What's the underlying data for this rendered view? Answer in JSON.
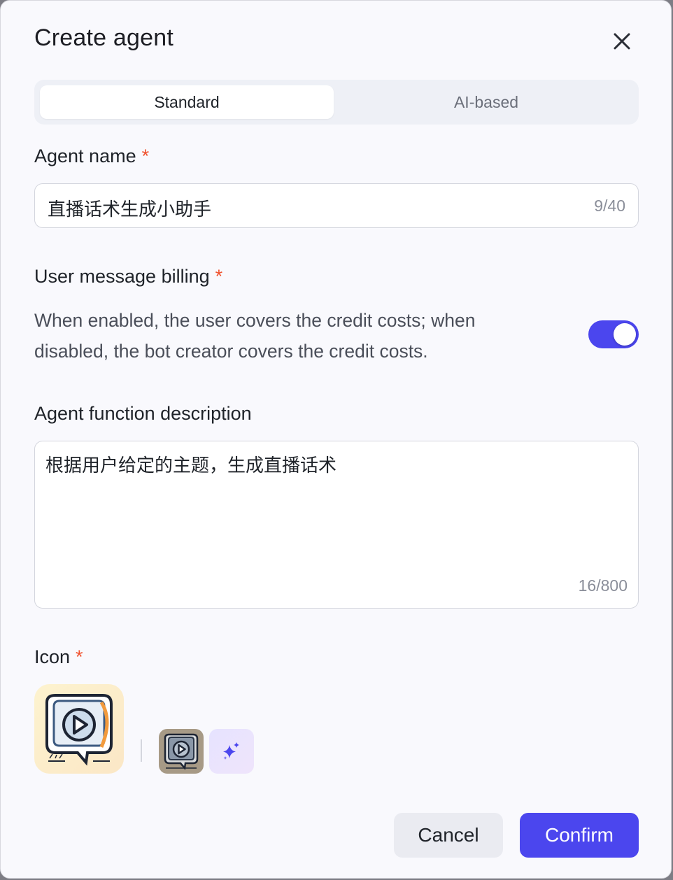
{
  "dialog": {
    "title": "Create agent",
    "close_icon": "close-icon"
  },
  "mode_tabs": [
    {
      "label": "Standard",
      "active": true
    },
    {
      "label": "AI-based",
      "active": false
    }
  ],
  "agent_name": {
    "label": "Agent name",
    "required_mark": "*",
    "value": "直播话术生成小助手",
    "counter": "9/40"
  },
  "billing": {
    "label": "User message billing",
    "required_mark": "*",
    "description_line1": "When enabled, the user covers the credit costs; when",
    "description_line2": "disabled, the bot creator covers the credit costs.",
    "toggle_on": true
  },
  "function_description": {
    "label": "Agent function description",
    "value": "根据用户给定的主题，生成直播话术",
    "counter": "16/800"
  },
  "icon": {
    "label": "Icon",
    "required_mark": "*",
    "preview_icon": "live-chat-play-icon",
    "ai_generate_icon": "sparkle-icon"
  },
  "footer": {
    "cancel_label": "Cancel",
    "confirm_label": "Confirm"
  },
  "colors": {
    "accent": "#4b46ee",
    "required": "#f0512d",
    "background": "#f9f9fd"
  }
}
